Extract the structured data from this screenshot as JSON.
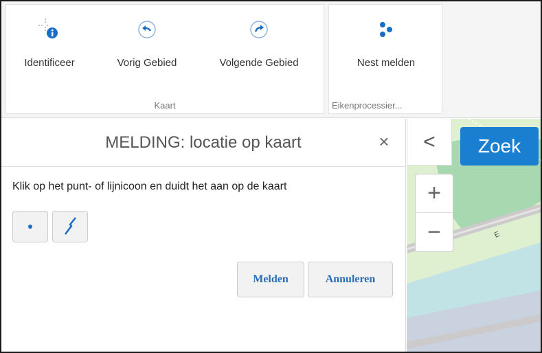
{
  "ribbon": {
    "groups": [
      {
        "label": "Kaart",
        "buttons": [
          {
            "label": "Identificeer",
            "icon": "identify-icon"
          },
          {
            "label": "Vorig Gebied",
            "icon": "arrow-left-icon"
          },
          {
            "label": "Volgende Gebied",
            "icon": "arrow-right-icon"
          }
        ]
      },
      {
        "label": "Eikenprocessier...",
        "buttons": [
          {
            "label": "Nest melden",
            "icon": "nest-icon"
          }
        ]
      }
    ]
  },
  "panel": {
    "title": "MELDING: locatie op kaart",
    "close_symbol": "×",
    "instruction": "Klik op het punt- of lijnicoon en duidt het aan op de kaart",
    "tools": [
      {
        "name": "point",
        "icon": "point-icon"
      },
      {
        "name": "line",
        "icon": "line-icon"
      }
    ],
    "actions": {
      "submit_label": "Melden",
      "cancel_label": "Annuleren"
    }
  },
  "map": {
    "collapse_symbol": "<",
    "search_label": "Zoek",
    "zoom_in_symbol": "+",
    "zoom_out_symbol": "−",
    "road_label": "E"
  },
  "colors": {
    "accent": "#1a6fc4",
    "search_button": "#1a7fd0",
    "map_green": "#dff0d0",
    "map_park": "#a8d8b0",
    "map_water": "#bde0ea",
    "map_road": "#cccaca"
  }
}
